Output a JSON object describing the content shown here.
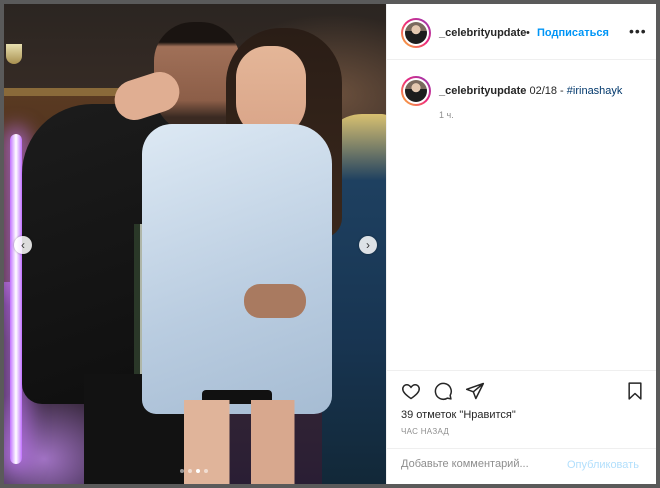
{
  "post": {
    "username": "_celebrityupdate",
    "follow_label": "Подписаться",
    "separator": "•",
    "more_label": "•••",
    "caption_user": "_celebrityupdate",
    "caption_text": " 02/18 - ",
    "caption_tag": "#irinashayk",
    "caption_time": "1 ч.",
    "likes_text": "39 отметок \"Нравится\"",
    "posted_ago": "ЧАС НАЗАД",
    "comment_placeholder": "Добавьте комментарий...",
    "publish_label": "Опубликовать"
  },
  "carousel": {
    "prev_label": "‹",
    "next_label": "›",
    "total_slides": 4,
    "current_slide": 3
  },
  "icons": {
    "like": "heart-icon",
    "comment": "comment-icon",
    "share": "share-icon",
    "save": "bookmark-icon",
    "more": "more-icon"
  },
  "colors": {
    "link_blue": "#0095f6",
    "publish_disabled": "#b2dffc",
    "tag": "#00376b"
  }
}
